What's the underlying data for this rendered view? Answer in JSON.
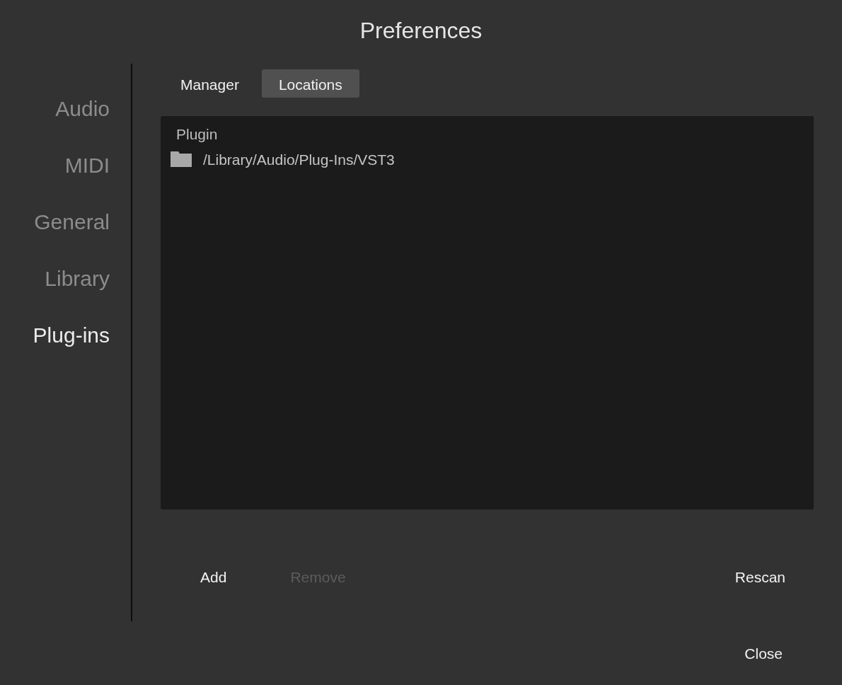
{
  "window": {
    "title": "Preferences"
  },
  "sidebar": {
    "items": [
      {
        "label": "Audio",
        "selected": false
      },
      {
        "label": "MIDI",
        "selected": false
      },
      {
        "label": "General",
        "selected": false
      },
      {
        "label": "Library",
        "selected": false
      },
      {
        "label": "Plug-ins",
        "selected": true
      }
    ]
  },
  "tabs": [
    {
      "label": "Manager",
      "selected": false
    },
    {
      "label": "Locations",
      "selected": true
    }
  ],
  "locations": {
    "header": "Plugin",
    "rows": [
      {
        "path": "/Library/Audio/Plug-Ins/VST3",
        "selected": false
      }
    ]
  },
  "actions": [
    {
      "label": "Add",
      "disabled": false
    },
    {
      "label": "Remove",
      "disabled": true
    },
    {
      "label": "Rescan",
      "disabled": false
    }
  ],
  "footer": {
    "close": "Close"
  }
}
